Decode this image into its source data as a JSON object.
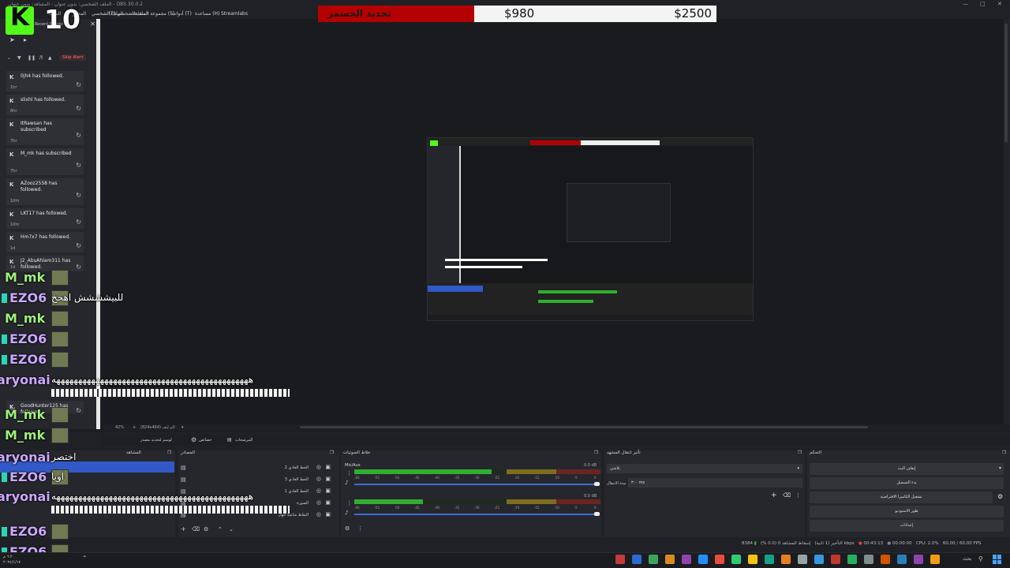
{
  "window": {
    "title": "الملف الشخصي: بدون عنوان - المشاهد: بدون عنوان - OBS 30.0.2"
  },
  "menu": {
    "items": [
      "الملف",
      "المحرر",
      "الملف الشخصي",
      "(P) الملف الشخصي",
      "مجموعة المشاهد (S)",
      "أدوات (T)",
      "مساعدة (H)",
      "Streamlabs"
    ]
  },
  "goal": {
    "label": "تحديد الجسمر",
    "current": "$980",
    "target": "$2500",
    "fraction": 0.392
  },
  "viewers": {
    "logo": "K",
    "count": "10"
  },
  "recent_events": {
    "title": "Recent Events",
    "skip_alert": "Skip Alert",
    "events": [
      {
        "name": "0jh4 has followed.",
        "time": "1hr"
      },
      {
        "name": "slixhl has followed.",
        "time": "6hr"
      },
      {
        "name": "ItRawsan has subscribed",
        "time": "7hr"
      },
      {
        "name": "M_mk has subscribed",
        "time": "7hr"
      },
      {
        "name": "AZooz2558 has followed.",
        "time": "10hr"
      },
      {
        "name": "LKT17 has followed.",
        "time": "10hr"
      },
      {
        "name": "Hm7x7 has followed.",
        "time": "1d"
      },
      {
        "name": "J2_AbuAhlam311 has followed.",
        "time": "1d"
      },
      {
        "name": "GoodHunter125 has followed.",
        "time": "1d"
      }
    ]
  },
  "chat": {
    "messages": [
      {
        "user": "M_mk",
        "text": ""
      },
      {
        "user": "EZO6",
        "text": "للبيشششش اهخخ"
      },
      {
        "user": "M_mk",
        "text": ""
      },
      {
        "user": "EZO6",
        "text": ""
      },
      {
        "user": "EZO6",
        "text": ""
      },
      {
        "user": "aryonai",
        "text": "هههههههههههههههههههههههههههههههههههههههههههههه"
      },
      {
        "user": "M_mk",
        "text": ""
      },
      {
        "user": "M_mk",
        "text": ""
      },
      {
        "user": "aryonai",
        "text": "اختصر"
      },
      {
        "user": "EZO6",
        "text": "اويا"
      },
      {
        "user": "aryonai",
        "text": "هههههههههههههههههههههههههههههههههههههههههههههه"
      },
      {
        "user": "EZO6",
        "text": ""
      },
      {
        "user": "EZO6",
        "text": ""
      }
    ]
  },
  "preview": {
    "zoom": "42%",
    "resolution": "(824x464) الم ليف",
    "hint": "لوسم لتحديد مصدر"
  },
  "toolbar": {
    "properties": "خصائص",
    "filters": "المرشحات"
  },
  "docks": {
    "scenes": {
      "title": "المشاهد"
    },
    "sources": {
      "title": "المصادر",
      "items": [
        "الخط العادي 2",
        "الخط العادي 3",
        "الخط العادي 1",
        "الصورة",
        "التقاط شاشة جهاز"
      ]
    },
    "mixer": {
      "title": "خلاط الصوتيات",
      "channels": [
        {
          "name": "Mic/Aux",
          "db": "0.0 dB",
          "level": 0.9
        },
        {
          "name": "",
          "db": "0.0 dB",
          "level": 0.45
        }
      ],
      "ticks": [
        "-60",
        "-55",
        "-50",
        "-45",
        "-40",
        "-35",
        "-30",
        "-25",
        "-20",
        "-15",
        "-10",
        "-5",
        "0"
      ]
    },
    "transitions": {
      "title": "تأثير انتقال المشهد",
      "type": "تلاشي",
      "duration_label": "مدة الانتقال",
      "duration": "٣٠٠ ms"
    },
    "controls": {
      "title": "التحكم",
      "buttons": [
        "إيقاف البث",
        "بدء التسجيل",
        "تشغيل الكاميرا الافتراضية",
        "طور الاستوديو",
        "إعدادات"
      ]
    }
  },
  "statusbar": {
    "dropped": "إسقاط المشاهد 0 (0.0 %)",
    "delay": "التأخير (1 ثانية)",
    "bitrate": "8384 kbps",
    "live_time": "00:43:13",
    "rec_time": "00:00:00",
    "cpu": "CPU: 2.0%",
    "fps": "60.00 / 60.00 FPS"
  },
  "taskbar": {
    "time": "٦:٢٠ م",
    "date": "٢٠٢٤/١/١٧",
    "search": "بحث"
  },
  "colors": {
    "kick_green": "#53fc18",
    "goal_red": "#b30000",
    "accent_blue": "#3b6fd6"
  }
}
